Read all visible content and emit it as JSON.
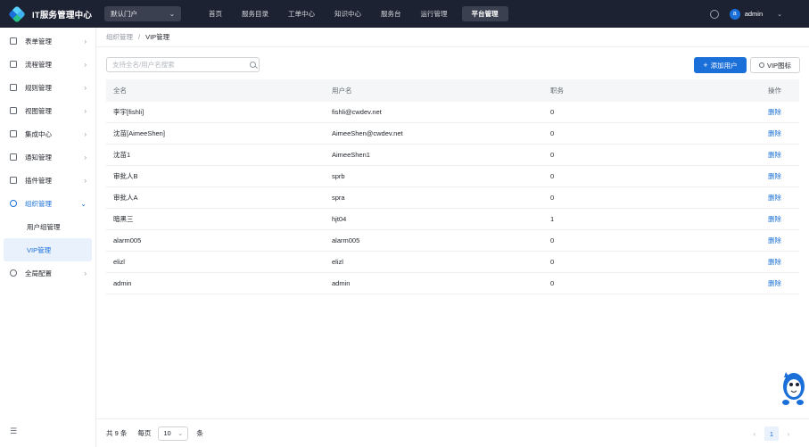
{
  "header": {
    "title": "IT服务管理中心",
    "portal_select": "默认门户",
    "nav": [
      "首页",
      "服务目录",
      "工单中心",
      "知识中心",
      "服务台",
      "运行管理"
    ],
    "nav_active": "平台管理",
    "user_initial": "a",
    "user_name": "admin"
  },
  "sidebar": {
    "items": [
      "表单管理",
      "流程管理",
      "规则管理",
      "视图管理",
      "集成中心",
      "通知管理",
      "插件管理"
    ],
    "open_item": "组织管理",
    "sub_items": [
      "用户组管理"
    ],
    "sub_active": "VIP管理",
    "bottom_item": "全局配置"
  },
  "breadcrumb": {
    "parent": "组织管理",
    "separator": "/",
    "current": "VIP管理"
  },
  "search": {
    "placeholder": "支持全名/用户名搜索"
  },
  "toolbar": {
    "add_label": "添加用户",
    "vip_label": "VIP图标"
  },
  "table": {
    "headers": [
      "全名",
      "用户名",
      "职务",
      "操作"
    ],
    "rows": [
      {
        "full_name": "李宇[fishli]",
        "username": "fishli@cwdev.net",
        "position": "0",
        "action": "删除"
      },
      {
        "full_name": "沈苗[AimeeShen]",
        "username": "AimeeShen@cwdev.net",
        "position": "0",
        "action": "删除"
      },
      {
        "full_name": "沈苗1",
        "username": "AimeeShen1",
        "position": "0",
        "action": "删除"
      },
      {
        "full_name": "审批人B",
        "username": "sprb",
        "position": "0",
        "action": "删除"
      },
      {
        "full_name": "审批人A",
        "username": "spra",
        "position": "0",
        "action": "删除"
      },
      {
        "full_name": "暗黑三",
        "username": "hjt04",
        "position": "1",
        "action": "删除"
      },
      {
        "full_name": "alarm005",
        "username": "alarm005",
        "position": "0",
        "action": "删除"
      },
      {
        "full_name": "elizl",
        "username": "elizl",
        "position": "0",
        "action": "删除"
      },
      {
        "full_name": "admin",
        "username": "admin",
        "position": "0",
        "action": "删除"
      }
    ]
  },
  "footer": {
    "total": "共 9 条",
    "per_page_label": "每页",
    "per_page_value": "10",
    "unit": "条",
    "current_page": "1"
  }
}
